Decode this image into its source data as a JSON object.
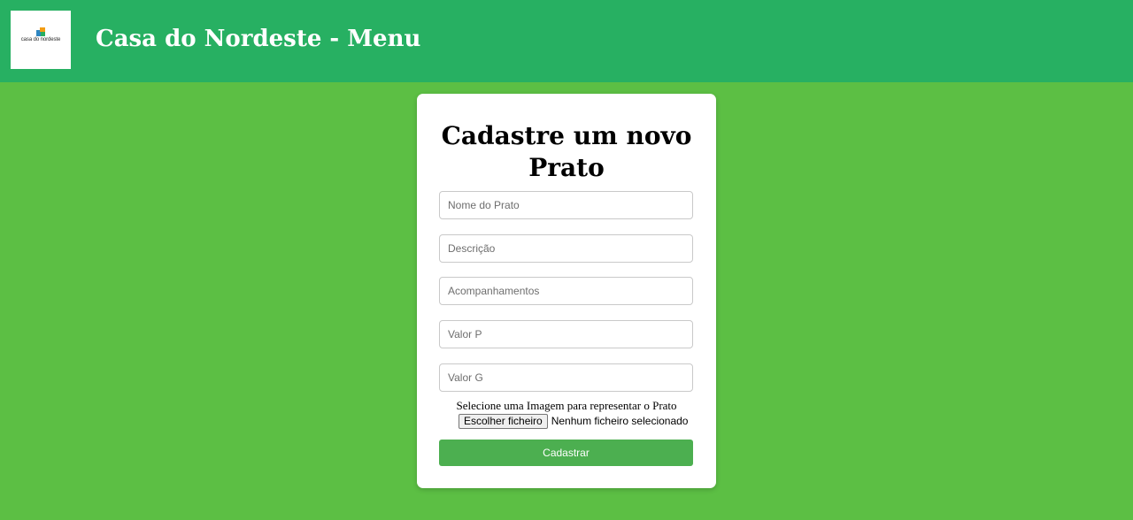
{
  "header": {
    "logo_text": "casa do nordeste",
    "title": "Casa do Nordeste - Menu"
  },
  "form": {
    "title": "Cadastre um novo Prato",
    "fields": [
      {
        "placeholder": "Nome do Prato",
        "value": ""
      },
      {
        "placeholder": "Descrição",
        "value": ""
      },
      {
        "placeholder": "Acompanhamentos",
        "value": ""
      },
      {
        "placeholder": "Valor P",
        "value": ""
      },
      {
        "placeholder": "Valor G",
        "value": ""
      }
    ],
    "image_label": "Selecione uma Imagem para representar o Prato",
    "file_button_label": "Escolher ficheiro",
    "file_status": "Nenhum ficheiro selecionado",
    "submit_label": "Cadastrar"
  },
  "colors": {
    "page_background": "#5cbf44",
    "header_background": "#27b062",
    "submit_background": "#4caf50"
  }
}
